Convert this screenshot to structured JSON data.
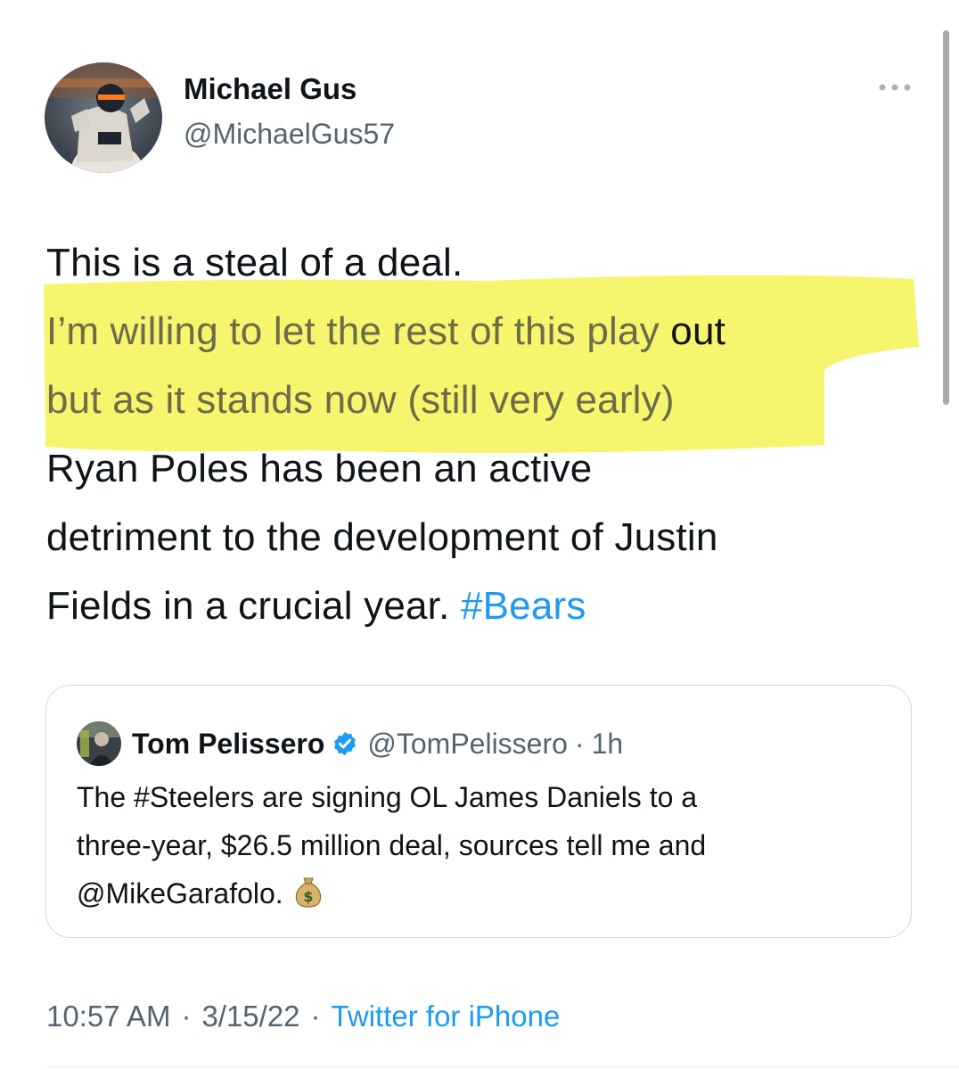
{
  "tweet": {
    "author": {
      "name": "Michael Gus",
      "handle": "@MichaelGus57"
    },
    "text_lines": [
      "This is a steal of a deal.",
      "I’m willing to let the rest of this play",
      " out",
      "but as it stands now (still very early)",
      "Ryan Poles has been an active",
      "detriment  to the development of Justin",
      "Fields in a crucial year. ",
      "#Bears"
    ],
    "time": "10:57 AM",
    "date": "3/15/22",
    "separator": "·",
    "source": "Twitter for iPhone"
  },
  "quoted": {
    "name": "Tom Pelissero",
    "handle": "@TomPelissero",
    "separator": "·",
    "age": "1h",
    "text_lines": [
      "The #Steelers are signing OL James Daniels to a",
      "three-year, $26.5 million deal, sources tell me and",
      "@MikeGarafolo."
    ],
    "emoji": "money-bag"
  },
  "icons": {
    "more": "ellipsis-icon",
    "verified": "verified-badge-icon"
  },
  "colors": {
    "highlight": "#f3f24a",
    "link": "#1d9bf0",
    "secondary_text": "#536471",
    "verified": "#1d9bf0"
  }
}
